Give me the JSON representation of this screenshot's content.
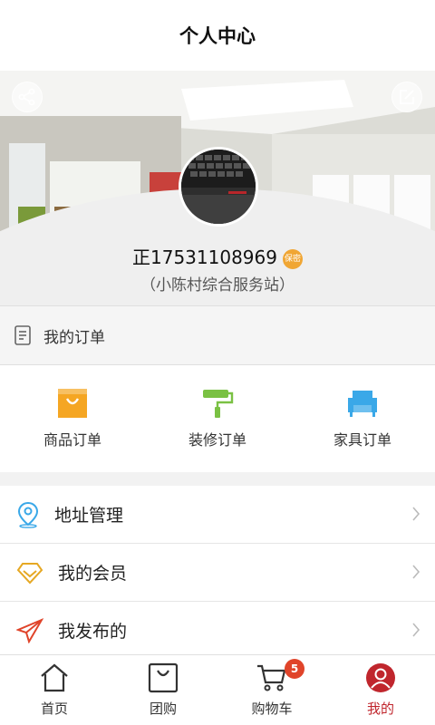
{
  "header": {
    "title": "个人中心"
  },
  "profile": {
    "name": "正17531108969",
    "gender_badge": "保密",
    "station": "（小陈村综合服务站）"
  },
  "orders": {
    "header_label": "我的订单",
    "types": [
      {
        "label": "商品订单",
        "icon": "shopping-bag-icon",
        "color": "#f5a623"
      },
      {
        "label": "装修订单",
        "icon": "paint-roller-icon",
        "color": "#7ac143"
      },
      {
        "label": "家具订单",
        "icon": "sofa-icon",
        "color": "#3aa8e8"
      }
    ]
  },
  "menu": [
    {
      "label": "地址管理",
      "icon": "location-pin-icon"
    },
    {
      "label": "我的会员",
      "icon": "diamond-icon"
    },
    {
      "label": "我发布的",
      "icon": "paper-plane-icon"
    }
  ],
  "tabbar": {
    "tabs": [
      {
        "label": "首页",
        "icon": "home-icon"
      },
      {
        "label": "团购",
        "icon": "bag-icon"
      },
      {
        "label": "购物车",
        "icon": "cart-icon",
        "badge": "5"
      },
      {
        "label": "我的",
        "icon": "user-icon"
      }
    ],
    "active_color": "#c0262d"
  }
}
